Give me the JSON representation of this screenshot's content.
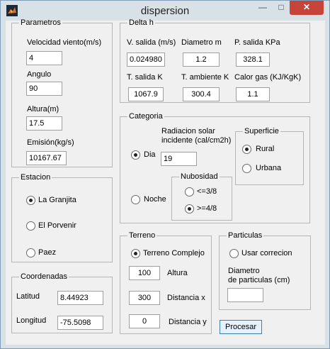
{
  "window": {
    "title": "dispersion",
    "minimize_symbol": "—",
    "maximize_symbol": "□",
    "close_symbol": "✕"
  },
  "parametros": {
    "legend": "Parametros",
    "velocidad_label": "Velocidad viento(m/s)",
    "velocidad_value": "4",
    "angulo_label": "Angulo",
    "angulo_value": "90",
    "altura_label": "Altura(m)",
    "altura_value": "17.5",
    "emision_label": "Emisión(kg/s)",
    "emision_value": "10167.67"
  },
  "delta": {
    "legend": "Delta h",
    "v_salida_label": "V. salida (m/s)",
    "v_salida_value": "0.024980",
    "diametro_label": "Diametro m",
    "diametro_value": "1.2",
    "p_salida_label": "P. salida KPa",
    "p_salida_value": "328.1",
    "t_salida_label": "T. salida K",
    "t_salida_value": "1067.9",
    "t_ambiente_label": "T. ambiente K",
    "t_ambiente_value": "300.4",
    "calor_label": "Calor gas (KJ/KgK)",
    "calor_value": "1.1"
  },
  "categoria": {
    "legend": "Categoria",
    "dia_label": "Dia",
    "noche_label": "Noche",
    "radiacion_label_1": "Radiacion solar",
    "radiacion_label_2": "incidente (cal/cm2h)",
    "radiacion_value": "19",
    "nubosidad_legend": "Nubosidad",
    "nub_low_label": "<=3/8",
    "nub_high_label": ">=4/8",
    "superficie_legend": "Superficie",
    "rural_label": "Rural",
    "urbana_label": "Urbana"
  },
  "estacion": {
    "legend": "Estacion",
    "options": [
      "La Granjita",
      "El Porvenir",
      "Paez"
    ]
  },
  "coordenadas": {
    "legend": "Coordenadas",
    "latitud_label": "Latitud",
    "latitud_value": "8.44923",
    "longitud_label": "Longitud",
    "longitud_value": "-75.5098"
  },
  "terreno": {
    "legend": "Terreno",
    "complejo_label": "Terreno Complejo",
    "altura_value": "100",
    "altura_label": "Altura",
    "distx_value": "300",
    "distx_label": "Distancia x",
    "disty_value": "0",
    "disty_label": "Distancia y"
  },
  "particulas": {
    "legend": "Particulas",
    "usar_label": "Usar correcion",
    "diam_label_1": "Diametro",
    "diam_label_2": "de particulas (cm)",
    "diam_value": ""
  },
  "actions": {
    "procesar_label": "Procesar"
  }
}
